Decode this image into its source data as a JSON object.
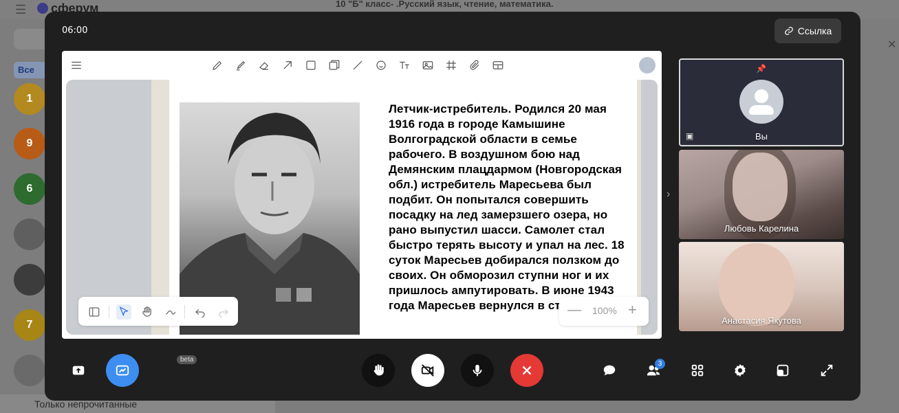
{
  "background": {
    "logo_text": "сферум",
    "chat_title": "10 \"Б\" класс- .Русский язык, чтение, математика.",
    "filter_chip": "Все",
    "avatars": [
      {
        "label": "1",
        "color": "#b38a1f"
      },
      {
        "label": "9",
        "color": "#b85b16"
      },
      {
        "label": "6",
        "color": "#2d6b2e"
      },
      {
        "label": "",
        "color": "#5f5f5f"
      },
      {
        "label": "",
        "color": "#3c3c3c"
      },
      {
        "label": "7",
        "color": "#a78616"
      },
      {
        "label": "",
        "color": "#6a6a6a"
      }
    ],
    "footer_text": "Только непрочитанные"
  },
  "call": {
    "timer": "06:00",
    "link_button": "Ссылка"
  },
  "whiteboard": {
    "toolbar_icons": [
      "pencil-icon",
      "marker-icon",
      "eraser-icon",
      "pointer-icon",
      "rectangle-icon",
      "sticker-icon",
      "line-icon",
      "emoji-icon",
      "text-icon",
      "image-icon",
      "grid-icon",
      "attachment-icon",
      "table-icon"
    ],
    "document_lines": [
      " Летчик-истребитель. Родился 20 мая",
      "1916 года в городе Камышине",
      "Волгоградской области в семье",
      "рабочего. В воздушном бою над",
      "Демянским плацдармом (Новгородская",
      "обл.) истребитель Маресьева был",
      "подбит. Он попытался совершить",
      "посадку на лед замерзшего озера, но",
      "рано выпустил шасси. Самолет стал",
      "быстро терять высоту и упал на лес. 18",
      "суток Маресьев добирался ползком до",
      "своих. Он обморозил ступни ног и их",
      "пришлось ампутировать. В июне 1943",
      "года Маресьев вернулся в ст"
    ],
    "zoom": "100%"
  },
  "participants": [
    {
      "name": "Вы"
    },
    {
      "name": "Любовь Карелина"
    },
    {
      "name": "Анастасия Якутова"
    }
  ],
  "controls": {
    "beta_label": "beta",
    "participants_count": "3"
  }
}
